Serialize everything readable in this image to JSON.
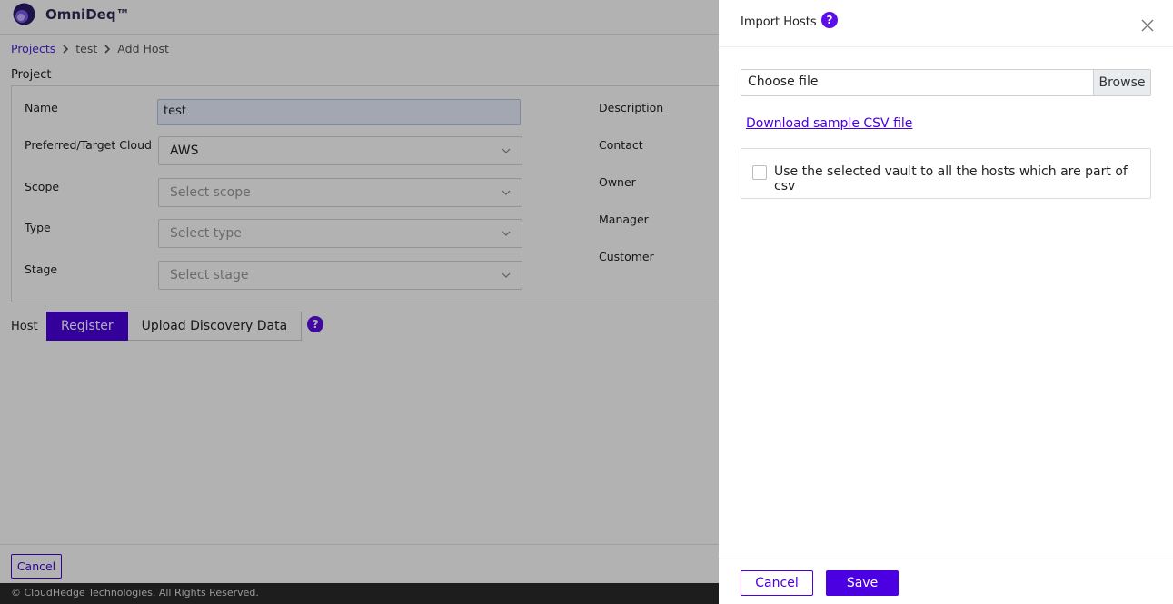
{
  "app": {
    "brand": "OmniDeq™",
    "accent_color": "#4a00e0"
  },
  "breadcrumb": {
    "projects": "Projects",
    "project": "test",
    "current": "Add Host"
  },
  "project_section": {
    "heading": "Project",
    "name_label": "Name",
    "name_value": "test",
    "cloud_label": "Preferred/Target Cloud",
    "cloud_value": "AWS",
    "scope_label": "Scope",
    "scope_placeholder": "Select scope",
    "type_label": "Type",
    "type_placeholder": "Select type",
    "stage_label": "Stage",
    "stage_placeholder": "Select stage",
    "description_label": "Description",
    "contact_label": "Contact",
    "owner_label": "Owner",
    "manager_label": "Manager",
    "customer_label": "Customer"
  },
  "host_section": {
    "label": "Host",
    "tabs": [
      "Register",
      "Upload Discovery Data"
    ],
    "help_glyph": "?"
  },
  "page_footer": {
    "cancel_label": "Cancel",
    "copyright": "© CloudHedge Technologies. All Rights Reserved."
  },
  "drawer": {
    "title": "Import Hosts",
    "help_glyph": "?",
    "file_placeholder": "Choose file",
    "browse_label": "Browse",
    "download_link": "Download sample CSV file",
    "vault_checkbox_label": "Use the selected vault to all the hosts which are part of csv",
    "cancel_label": "Cancel",
    "save_label": "Save"
  }
}
